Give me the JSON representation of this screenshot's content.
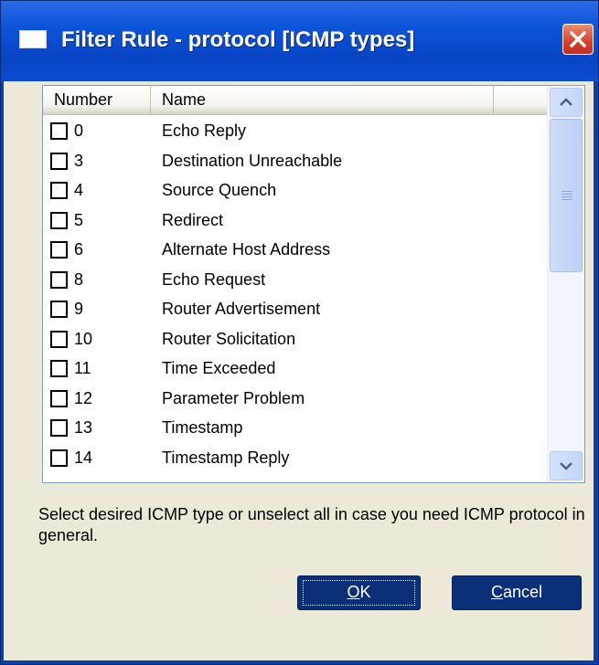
{
  "window": {
    "title": "Filter Rule - protocol [ICMP types]"
  },
  "list": {
    "columns": [
      "Number",
      "Name"
    ],
    "rows": [
      {
        "number": "0",
        "name": "Echo Reply",
        "checked": false
      },
      {
        "number": "3",
        "name": "Destination Unreachable",
        "checked": false
      },
      {
        "number": "4",
        "name": "Source Quench",
        "checked": false
      },
      {
        "number": "5",
        "name": "Redirect",
        "checked": false
      },
      {
        "number": "6",
        "name": "Alternate Host Address",
        "checked": false
      },
      {
        "number": "8",
        "name": "Echo Request",
        "checked": false
      },
      {
        "number": "9",
        "name": "Router Advertisement",
        "checked": false
      },
      {
        "number": "10",
        "name": "Router Solicitation",
        "checked": false
      },
      {
        "number": "11",
        "name": "Time Exceeded",
        "checked": false
      },
      {
        "number": "12",
        "name": "Parameter Problem",
        "checked": false
      },
      {
        "number": "13",
        "name": "Timestamp",
        "checked": false
      },
      {
        "number": "14",
        "name": "Timestamp Reply",
        "checked": false
      }
    ]
  },
  "description": "Select desired ICMP type or unselect all in case you need ICMP protocol in general.",
  "buttons": {
    "ok_label_accel": "O",
    "ok_label_rest": "K",
    "cancel_label_accel": "C",
    "cancel_label_rest": "ancel"
  },
  "colors": {
    "titlebar": "#0b52d8",
    "dialog_bg": "#ece9d8",
    "button_bg": "#0c2f7a",
    "close_button": "#d6402a"
  },
  "icons": [
    "window-icon",
    "close-icon",
    "scroll-up-icon",
    "scroll-down-icon"
  ]
}
